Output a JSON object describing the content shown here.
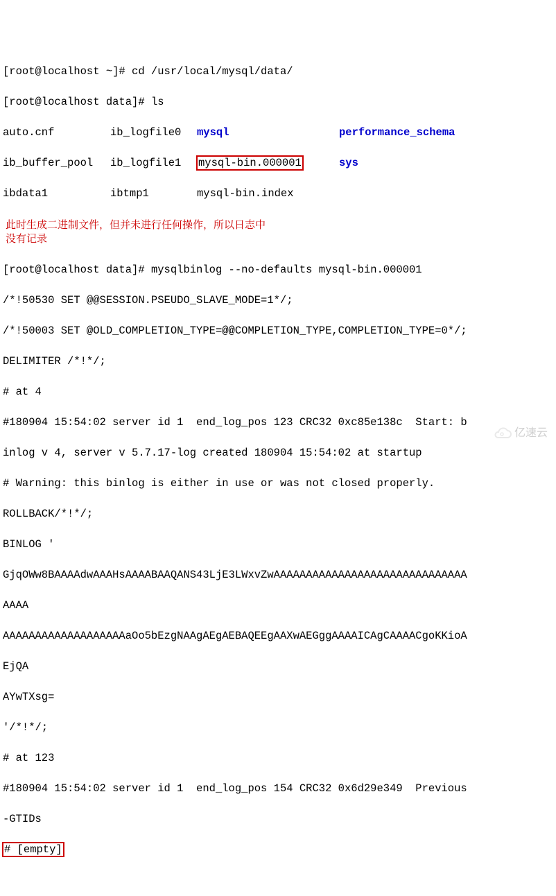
{
  "prompt1": "[root@localhost ~]# ",
  "cmd1": "cd /usr/local/mysql/data/",
  "prompt2": "[root@localhost data]# ",
  "cmd2": "ls",
  "ls": {
    "r1c1": "auto.cnf",
    "r1c2": "ib_logfile0",
    "r1c3": "mysql",
    "r1c4": "performance_schema",
    "r2c1": "ib_buffer_pool",
    "r2c2": "ib_logfile1",
    "r2c3": "mysql-bin.000001",
    "r2c4": "sys",
    "r3c1": "ibdata1",
    "r3c2": "ibtmp1",
    "r3c3": "mysql-bin.index"
  },
  "annotation": "此时生成二进制文件，但并未进行任何操作，所以日志中没有记录",
  "prompt3": "[root@localhost data]# ",
  "cmd3": "mysqlbinlog --no-defaults mysql-bin.000001",
  "out": {
    "l1": "/*!50530 SET @@SESSION.PSEUDO_SLAVE_MODE=1*/;",
    "l2": "/*!50003 SET @OLD_COMPLETION_TYPE=@@COMPLETION_TYPE,COMPLETION_TYPE=0*/;",
    "l3": "DELIMITER /*!*/;",
    "l4": "# at 4",
    "l5": "#180904 15:54:02 server id 1  end_log_pos 123 CRC32 0xc85e138c  Start: b",
    "l6": "inlog v 4, server v 5.7.17-log created 180904 15:54:02 at startup",
    "l7": "# Warning: this binlog is either in use or was not closed properly.",
    "l8": "ROLLBACK/*!*/;",
    "l9": "BINLOG '",
    "l10": "GjqOWw8BAAAAdwAAAHsAAAABAAQANS43LjE3LWxvZwAAAAAAAAAAAAAAAAAAAAAAAAAAAAAA",
    "l11": "AAAA",
    "l12": "AAAAAAAAAAAAAAAAAAAaOo5bEzgNAAgAEgAEBAQEEgAAXwAEGggAAAAICAgCAAAACgoKKioA",
    "l13": "EjQA",
    "l14": "AYwTXsg=",
    "l15": "'/*!*/;",
    "l16": "# at 123",
    "l17": "#180904 15:54:02 server id 1  end_log_pos 154 CRC32 0x6d29e349  Previous",
    "l18": "-GTIDs",
    "l19": "# [empty]"
  },
  "watermark": "亿速云"
}
